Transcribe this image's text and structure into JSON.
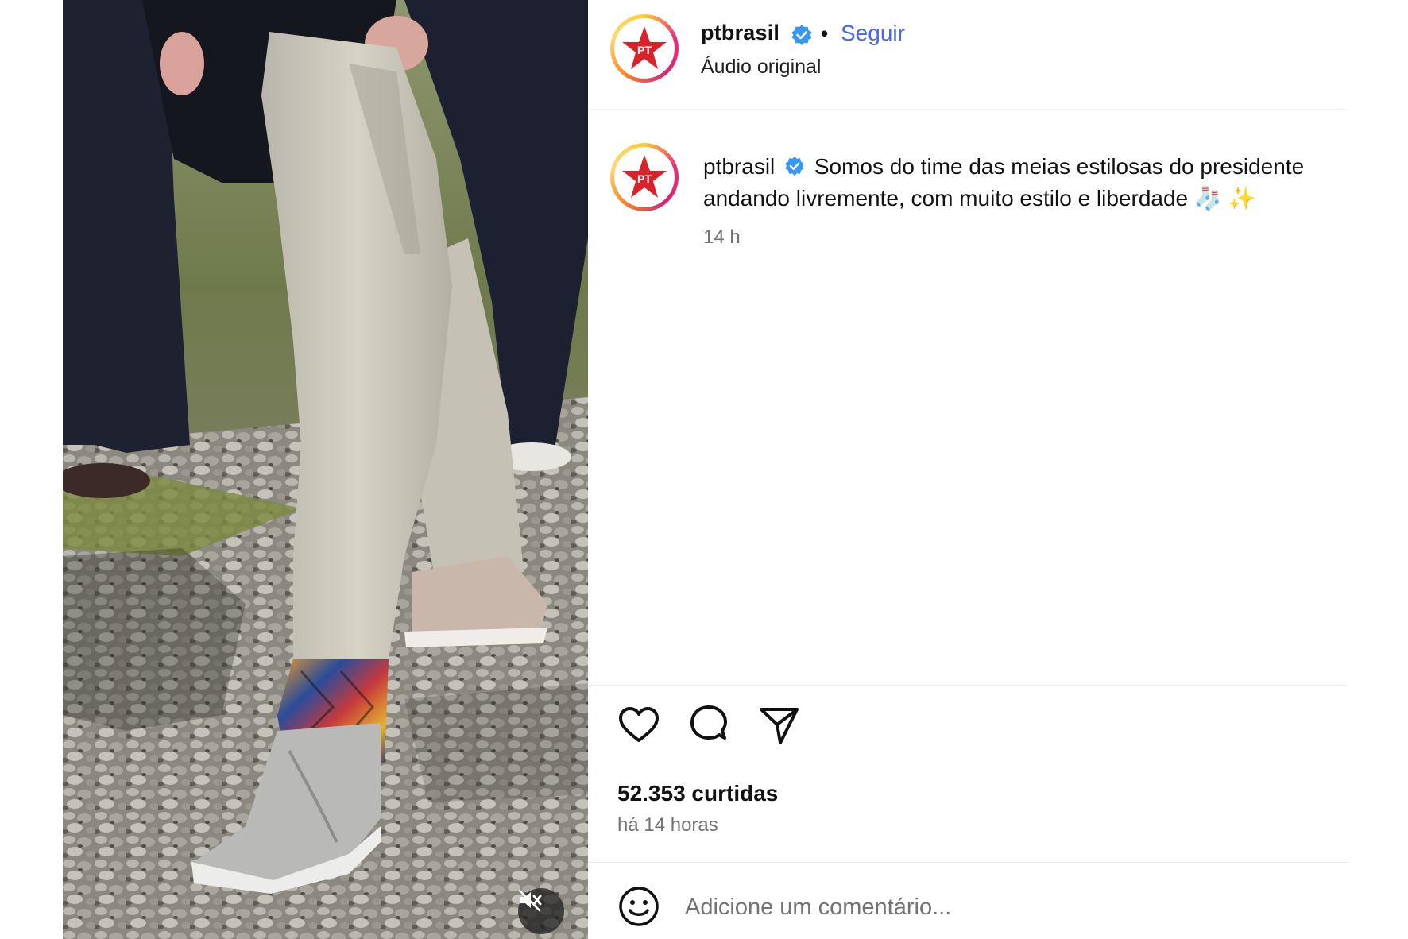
{
  "post": {
    "username": "ptbrasil",
    "follow_label": "Seguir",
    "separator": "•",
    "audio": "Áudio original",
    "avatar_text": "PT",
    "caption": "Somos do time das meias estilosas do presidente andando livremente, com muito estilo e liberdade 🧦 ✨",
    "caption_time": "14 h",
    "likes": "52.353 curtidas",
    "time_ago": "há 14 horas",
    "comment_placeholder": "Adicione um comentário..."
  },
  "icons": {
    "verified": "verified-badge-icon",
    "like": "heart-icon",
    "comment": "comment-bubble-icon",
    "share": "paper-plane-icon",
    "emoji": "smiley-icon",
    "mute": "speaker-muted-icon"
  },
  "colors": {
    "follow": "#4a67e8",
    "verified": "#3897f0",
    "pt_red": "#d8232a",
    "muted_text": "#737373"
  }
}
